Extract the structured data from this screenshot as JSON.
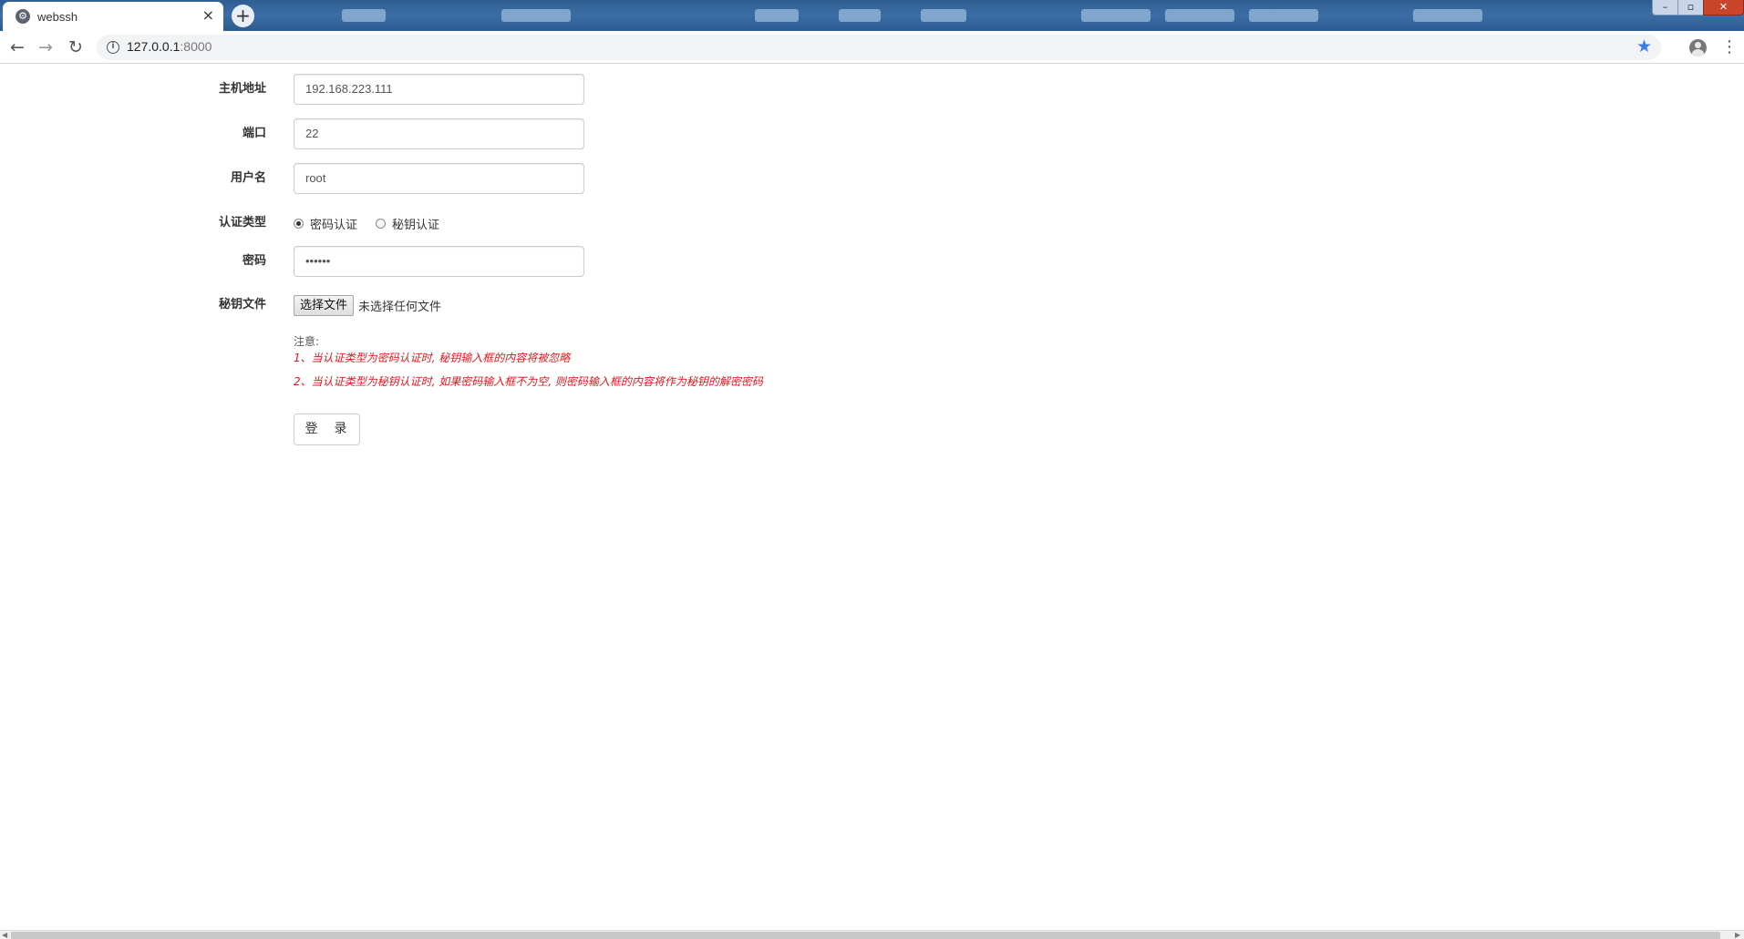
{
  "browser": {
    "tab_title": "webssh",
    "tab_close_glyph": "×",
    "new_tab_glyph": "+",
    "favicon_glyph": "⚙",
    "url_host": "127.0.0.1",
    "url_port": ":8000",
    "window_controls": {
      "minimize": "–",
      "maximize": "▫",
      "close": "✕"
    },
    "nav_icons": {
      "back": "←",
      "forward": "→",
      "reload": "↻",
      "info": "i",
      "star": "★",
      "menu": "⋮"
    },
    "accent_color": "#3b7ce6"
  },
  "form": {
    "host": {
      "label": "主机地址",
      "value": "192.168.223.111"
    },
    "port": {
      "label": "端口",
      "value": "22"
    },
    "username": {
      "label": "用户名",
      "value": "root"
    },
    "auth_type": {
      "label": "认证类型",
      "options": [
        {
          "label": "密码认证",
          "selected": true
        },
        {
          "label": "秘钥认证",
          "selected": false
        }
      ]
    },
    "password": {
      "label": "密码",
      "value": "••••••"
    },
    "keyfile": {
      "label": "秘钥文件",
      "button": "选择文件",
      "status": "未选择任何文件"
    }
  },
  "notes": {
    "heading": "注意:",
    "items": [
      "1、当认证类型为密码认证时, 秘钥输入框的内容将被忽略",
      "2、当认证类型为秘钥认证时, 如果密码输入框不为空, 则密码输入框的内容将作为秘钥的解密密码"
    ],
    "color": "#e4141c"
  },
  "login_button": "登　录"
}
